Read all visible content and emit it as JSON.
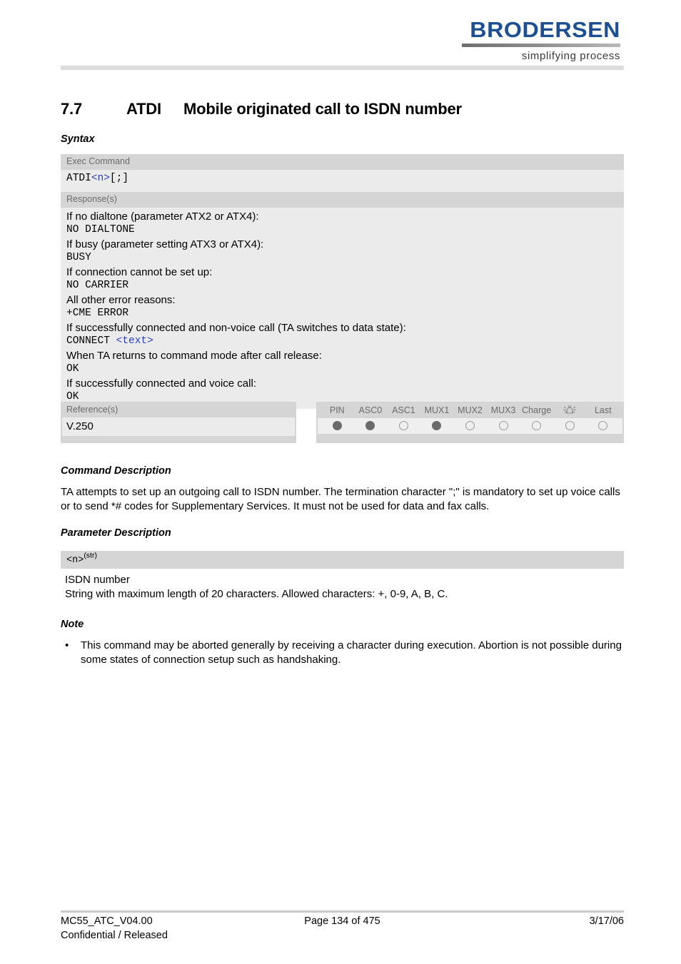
{
  "header": {
    "logo_word": "BRODERSEN",
    "logo_tagline": "simplifying process"
  },
  "section": {
    "number": "7.7",
    "command": "ATDI",
    "title": "Mobile originated call to ISDN number"
  },
  "headings": {
    "syntax": "Syntax",
    "command_description": "Command Description",
    "parameter_description": "Parameter Description",
    "note": "Note"
  },
  "syntax": {
    "exec_label": "Exec Command",
    "exec_prefix": "ATDI",
    "exec_param": "<n>",
    "exec_suffix": "[;]",
    "response_label": "Response(s)",
    "responses": [
      {
        "text": "If no dialtone (parameter ATX2 or ATX4):",
        "style": "prose"
      },
      {
        "text": "NO DIALTONE",
        "style": "mono"
      },
      {
        "text": "If busy (parameter setting ATX3 or ATX4):",
        "style": "prose"
      },
      {
        "text": "BUSY",
        "style": "mono"
      },
      {
        "text": "If connection cannot be set up:",
        "style": "prose"
      },
      {
        "text": "NO CARRIER",
        "style": "mono"
      },
      {
        "text": "All other error reasons:",
        "style": "prose"
      },
      {
        "text": "+CME ERROR",
        "style": "mono"
      },
      {
        "text": "If successfully connected and non-voice call (TA switches to data state):",
        "style": "prose"
      },
      {
        "text": "CONNECT ",
        "style": "mono",
        "blue_tail": "<text>"
      },
      {
        "text": "When TA returns to command mode after call release:",
        "style": "prose"
      },
      {
        "text": "OK",
        "style": "mono"
      },
      {
        "text": "If successfully connected and voice call:",
        "style": "prose"
      },
      {
        "text": "OK",
        "style": "mono"
      }
    ]
  },
  "reference": {
    "label": "Reference(s)",
    "value": "V.250"
  },
  "indicators": {
    "columns": [
      "PIN",
      "ASC0",
      "ASC1",
      "MUX1",
      "MUX2",
      "MUX3",
      "Charge",
      "alarm-bell-icon",
      "Last"
    ],
    "states": [
      "on",
      "on",
      "off",
      "on",
      "off",
      "off",
      "off",
      "off",
      "off"
    ]
  },
  "command_description": {
    "line1": "TA attempts to set up an outgoing call to ISDN number. The termination character \";\" is mandatory to set up voice",
    "line2": "calls or to send *# codes for Supplementary Services. It must not be used for data and fax calls."
  },
  "parameter": {
    "name": "<n>",
    "type_sup": "(str)",
    "line1": "ISDN number",
    "line2": "String with maximum length of 20 characters. Allowed characters: +, 0-9, A, B, C."
  },
  "note": {
    "bullet": "•",
    "line1": "This command may be aborted generally by receiving a character during execution. Abortion is not possible",
    "line2": "during some states of connection setup such as handshaking."
  },
  "footer": {
    "doc_id": "MC55_ATC_V04.00",
    "classification": "Confidential / Released",
    "page": "Page 134 of 475",
    "date": "3/17/06"
  },
  "colors": {
    "logo_blue": "#1d4f93",
    "param_blue": "#2a3fbe",
    "band_gray": "#d5d5d5",
    "body_gray": "#ebebeb",
    "dot_on": "#6a6a6a"
  }
}
